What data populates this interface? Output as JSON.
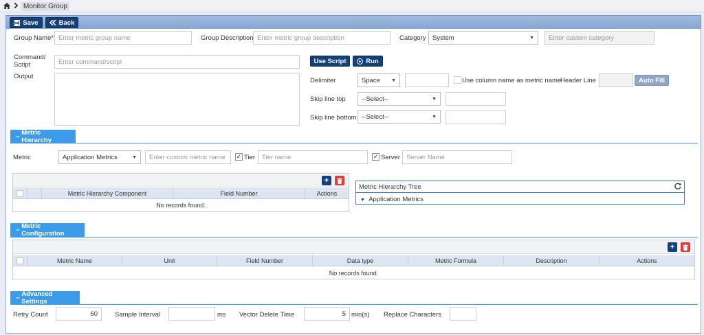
{
  "breadcrumb": {
    "home_icon": "home-icon",
    "separator_icon": "chevron-right-icon",
    "current": "Monitor Group"
  },
  "toolbar": {
    "save_label": "Save",
    "back_label": "Back"
  },
  "form": {
    "group_name_label": "Group Name",
    "required_mark": "*",
    "group_name_placeholder": "Enter metric group name",
    "group_description_label": "Group Description",
    "group_description_placeholder": "Enter metric group description",
    "category_label": "Category",
    "category_value": "System",
    "custom_category_placeholder": "Enter custom category",
    "command_label_1": "Command/",
    "command_label_2": "Script",
    "command_placeholder": "Enter command/script",
    "use_script_label": "Use Script",
    "run_label": "Run",
    "output_label": "Output",
    "delimiter_label": "Delimiter",
    "delimiter_value": "Space",
    "use_column_name_label": "Use column name as metric name",
    "header_line_label": "Header Line",
    "auto_fill_label": "Auto Fill",
    "skip_top_label": "Skip line top",
    "skip_top_value": "--Select--",
    "skip_bottom_label": "Skip line bottom",
    "skip_bottom_value": "--Select--"
  },
  "metric_hierarchy": {
    "title": "Metric Hierarchy",
    "metric_label": "Metric",
    "metric_value": "Application Metrics",
    "custom_metric_placeholder": "Enter custom metric name",
    "tier_label": "Tier",
    "tier_placeholder": "Tier name",
    "server_label": "Server",
    "server_placeholder": "Server Name",
    "columns": [
      "Metric Hierarchy Component",
      "Field Number",
      "Actions"
    ],
    "empty_text": "No records found.",
    "tree_title": "Metric Hierarchy Tree",
    "tree_root": "Application Metrics"
  },
  "metric_configuration": {
    "title": "Metric Configuration",
    "columns": [
      "Metric Name",
      "Unit",
      "Field Number",
      "Data type",
      "Metric Formula",
      "Description",
      "Actions"
    ],
    "empty_text": "No records found."
  },
  "advanced_settings": {
    "title": "Advanced Settings",
    "retry_count_label": "Retry Count",
    "retry_count_value": "60",
    "sample_interval_label": "Sample Interval",
    "sample_interval_unit": "ms",
    "vector_delete_label": "Vector Delete Time",
    "vector_delete_value": "5",
    "vector_delete_unit": "min(s)",
    "replace_chars_label": "Replace Characters"
  },
  "colors": {
    "primary": "#15407b",
    "section": "#3b9be8",
    "delete": "#e43b3b",
    "toolbar": "#9fbbe0"
  }
}
